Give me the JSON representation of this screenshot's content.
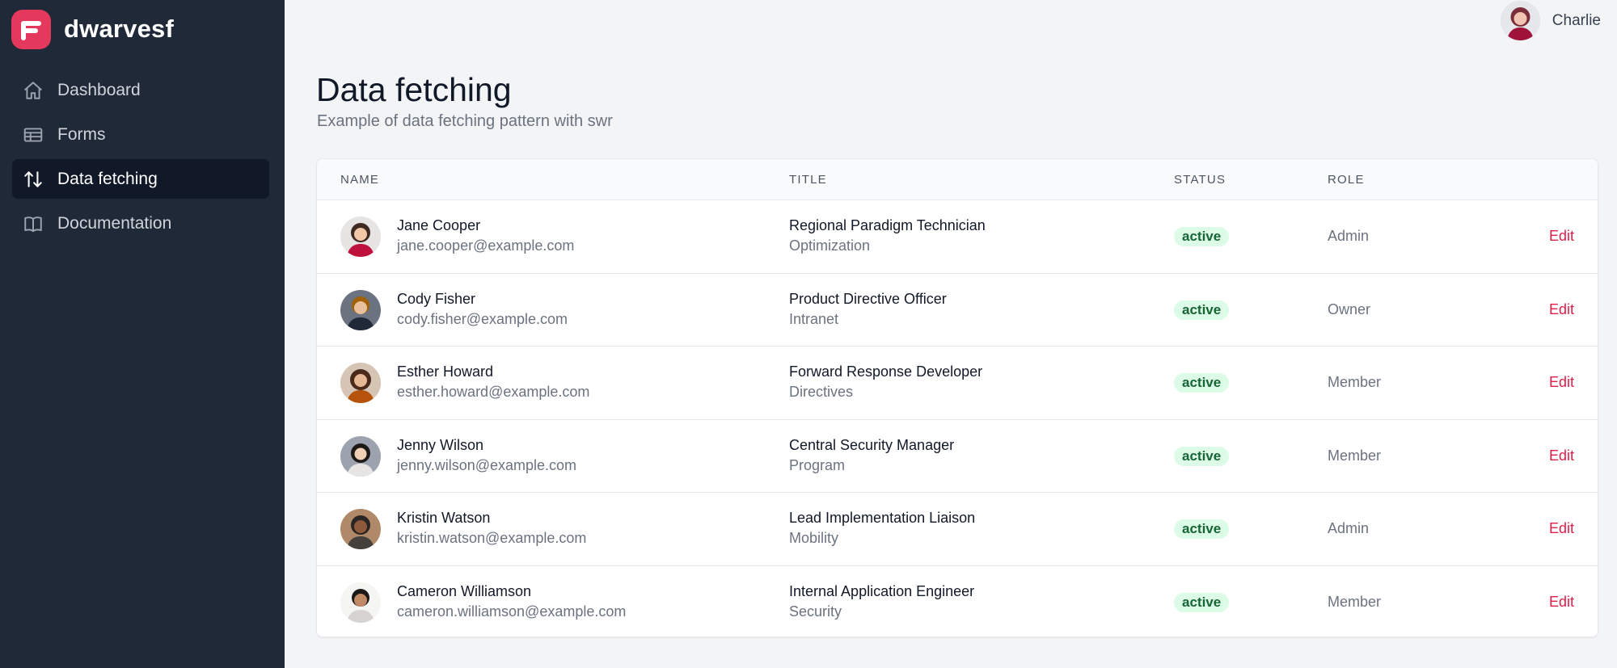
{
  "brand": {
    "name": "dwarvesf",
    "color": "#e5385d"
  },
  "sidebar": {
    "items": [
      {
        "label": "Dashboard",
        "icon": "home-icon",
        "active": false
      },
      {
        "label": "Forms",
        "icon": "table-icon",
        "active": false
      },
      {
        "label": "Data fetching",
        "icon": "arrows-up-down-icon",
        "active": true
      },
      {
        "label": "Documentation",
        "icon": "book-open-icon",
        "active": false
      }
    ]
  },
  "user": {
    "name": "Charlie"
  },
  "header": {
    "title": "Data fetching",
    "subtitle": "Example of data fetching pattern with swr"
  },
  "table": {
    "columns": [
      "NAME",
      "TITLE",
      "STATUS",
      "ROLE"
    ],
    "edit_label": "Edit",
    "rows": [
      {
        "name": "Jane Cooper",
        "email": "jane.cooper@example.com",
        "title": "Regional Paradigm Technician",
        "department": "Optimization",
        "status": "active",
        "role": "Admin"
      },
      {
        "name": "Cody Fisher",
        "email": "cody.fisher@example.com",
        "title": "Product Directive Officer",
        "department": "Intranet",
        "status": "active",
        "role": "Owner"
      },
      {
        "name": "Esther Howard",
        "email": "esther.howard@example.com",
        "title": "Forward Response Developer",
        "department": "Directives",
        "status": "active",
        "role": "Member"
      },
      {
        "name": "Jenny Wilson",
        "email": "jenny.wilson@example.com",
        "title": "Central Security Manager",
        "department": "Program",
        "status": "active",
        "role": "Member"
      },
      {
        "name": "Kristin Watson",
        "email": "kristin.watson@example.com",
        "title": "Lead Implementation Liaison",
        "department": "Mobility",
        "status": "active",
        "role": "Admin"
      },
      {
        "name": "Cameron Williamson",
        "email": "cameron.williamson@example.com",
        "title": "Internal Application Engineer",
        "department": "Security",
        "status": "active",
        "role": "Member"
      }
    ]
  }
}
